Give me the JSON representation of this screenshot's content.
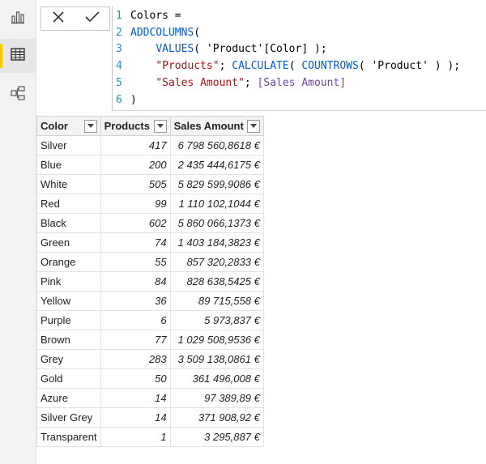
{
  "formula": {
    "cancel_icon": "close-icon",
    "commit_icon": "check-icon",
    "lines": [
      {
        "no": "1",
        "parts": [
          {
            "t": "Colors =",
            "c": "code"
          }
        ]
      },
      {
        "no": "2",
        "parts": [
          {
            "t": "ADDCOLUMNS",
            "c": "kw"
          },
          {
            "t": "(",
            "c": "code"
          }
        ]
      },
      {
        "no": "3",
        "parts": [
          {
            "t": "    ",
            "c": "code"
          },
          {
            "t": "VALUES",
            "c": "kw"
          },
          {
            "t": "( 'Product'[Color] );",
            "c": "code"
          }
        ]
      },
      {
        "no": "4",
        "parts": [
          {
            "t": "    ",
            "c": "code"
          },
          {
            "t": "\"Products\"",
            "c": "str"
          },
          {
            "t": "; ",
            "c": "code"
          },
          {
            "t": "CALCULATE",
            "c": "kw"
          },
          {
            "t": "( ",
            "c": "code"
          },
          {
            "t": "COUNTROWS",
            "c": "kw"
          },
          {
            "t": "( 'Product' ) );",
            "c": "code"
          }
        ]
      },
      {
        "no": "5",
        "parts": [
          {
            "t": "    ",
            "c": "code"
          },
          {
            "t": "\"Sales Amount\"",
            "c": "str"
          },
          {
            "t": "; ",
            "c": "code"
          },
          {
            "t": "[Sales Amount]",
            "c": "meas"
          }
        ]
      },
      {
        "no": "6",
        "parts": [
          {
            "t": ")",
            "c": "code"
          }
        ]
      }
    ]
  },
  "rail": {
    "report_icon": "bar-chart-icon",
    "data_icon": "table-icon",
    "model_icon": "model-icon"
  },
  "table": {
    "columns": [
      "Color",
      "Products",
      "Sales Amount"
    ],
    "rows": [
      [
        "Silver",
        "417",
        "6 798 560,8618 €"
      ],
      [
        "Blue",
        "200",
        "2 435 444,6175 €"
      ],
      [
        "White",
        "505",
        "5 829 599,9086 €"
      ],
      [
        "Red",
        "99",
        "1 110 102,1044 €"
      ],
      [
        "Black",
        "602",
        "5 860 066,1373 €"
      ],
      [
        "Green",
        "74",
        "1 403 184,3823 €"
      ],
      [
        "Orange",
        "55",
        "857 320,2833 €"
      ],
      [
        "Pink",
        "84",
        "828 638,5425 €"
      ],
      [
        "Yellow",
        "36",
        "89 715,558 €"
      ],
      [
        "Purple",
        "6",
        "5 973,837 €"
      ],
      [
        "Brown",
        "77",
        "1 029 508,9536 €"
      ],
      [
        "Grey",
        "283",
        "3 509 138,0861 €"
      ],
      [
        "Gold",
        "50",
        "361 496,008 €"
      ],
      [
        "Azure",
        "14",
        "97 389,89 €"
      ],
      [
        "Silver Grey",
        "14",
        "371 908,92 €"
      ],
      [
        "Transparent",
        "1",
        "3 295,887 €"
      ]
    ]
  },
  "colors": {
    "accent": "#f2c811",
    "keyword": "#035aca",
    "string": "#a31515",
    "measure": "#6f42a8",
    "line_number": "#2b91af"
  }
}
